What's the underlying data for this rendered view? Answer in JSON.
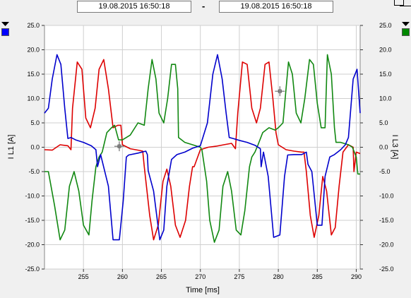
{
  "header": {
    "time_from": "19.08.2015     16:50:18",
    "separator": "-",
    "time_to": "19.08.2015     16:50:18"
  },
  "colors": {
    "I_L1": "#0000cc",
    "I_L2": "#dd0000",
    "I_L3": "#118811",
    "left_swatch": "#0000ff",
    "right_swatch": "#008800"
  },
  "icons": [
    "dropdown-arrow-icon",
    "window-restore-icon",
    "cursor-crosshair-icon"
  ],
  "chart_data": {
    "type": "line",
    "xlabel": "Time [ms]",
    "ylabel_left": "I L1 [A]",
    "ylabel_right": "I L3 [A]",
    "xlim": [
      250,
      290.5
    ],
    "ylim": [
      -25,
      25
    ],
    "x_ticks": [
      255,
      260,
      265,
      270,
      275,
      280,
      285,
      290
    ],
    "y_ticks": [
      "25.0",
      "20.0",
      "15.0",
      "10.0",
      "5.0",
      "0.0",
      "-5.0",
      "-10.0",
      "-15.0",
      "-20.0",
      "-25.0"
    ],
    "grid": true,
    "series": [
      {
        "key": "I_L1",
        "points": [
          [
            250,
            7
          ],
          [
            250.5,
            8
          ],
          [
            251,
            14
          ],
          [
            251.6,
            19
          ],
          [
            252.1,
            17
          ],
          [
            252.6,
            8
          ],
          [
            253,
            1.8
          ],
          [
            253.4,
            2
          ],
          [
            254,
            1.5
          ],
          [
            255,
            1
          ],
          [
            256,
            0.3
          ],
          [
            256.6,
            -0.5
          ],
          [
            256.8,
            -4
          ],
          [
            257.2,
            -1.5
          ],
          [
            258.2,
            -8
          ],
          [
            258.8,
            -19
          ],
          [
            259.6,
            -19
          ],
          [
            260.1,
            -11
          ],
          [
            260.5,
            -2
          ],
          [
            260.8,
            -1.6
          ],
          [
            262,
            -1.2
          ],
          [
            263,
            -0.8
          ],
          [
            263.2,
            -1.5
          ],
          [
            263.3,
            -4.8
          ],
          [
            264,
            -9
          ],
          [
            264.8,
            -19
          ],
          [
            265.3,
            -17
          ],
          [
            265.7,
            -8
          ],
          [
            266.3,
            -2.5
          ],
          [
            267,
            -1.5
          ],
          [
            268,
            -1
          ],
          [
            269,
            -0.2
          ],
          [
            270,
            0.3
          ],
          [
            270.9,
            5
          ],
          [
            271.6,
            15
          ],
          [
            272.2,
            19
          ],
          [
            272.8,
            14
          ],
          [
            273.3,
            7
          ],
          [
            273.7,
            2
          ],
          [
            274.2,
            1.8
          ],
          [
            275,
            1.4
          ],
          [
            276,
            1
          ],
          [
            277,
            0.4
          ],
          [
            277.7,
            -0.3
          ],
          [
            277.8,
            -4
          ],
          [
            278.1,
            -1
          ],
          [
            278.7,
            -6
          ],
          [
            279.4,
            -18.5
          ],
          [
            280.2,
            -18
          ],
          [
            280.8,
            -6
          ],
          [
            281.2,
            -1.6
          ],
          [
            282,
            -1.5
          ],
          [
            283,
            -1.5
          ],
          [
            283.6,
            -1
          ],
          [
            283.8,
            -3.5
          ],
          [
            284.3,
            -5
          ],
          [
            285,
            -16
          ],
          [
            285.6,
            -16
          ],
          [
            286,
            -6
          ],
          [
            286.6,
            -2
          ],
          [
            287.2,
            -1.5
          ],
          [
            288,
            -0.5
          ],
          [
            288.6,
            0.5
          ],
          [
            289,
            2
          ],
          [
            289.6,
            14
          ],
          [
            290.1,
            16
          ],
          [
            290.5,
            7
          ]
        ]
      },
      {
        "key": "I_L2",
        "points": [
          [
            250,
            -0.5
          ],
          [
            251,
            -0.6
          ],
          [
            252,
            0.5
          ],
          [
            253,
            0.3
          ],
          [
            253.4,
            -0.5
          ],
          [
            253.6,
            8
          ],
          [
            254.2,
            17.5
          ],
          [
            254.8,
            16
          ],
          [
            255.3,
            6
          ],
          [
            255.9,
            4
          ],
          [
            256.5,
            8
          ],
          [
            257,
            16
          ],
          [
            257.6,
            18
          ],
          [
            258.2,
            12
          ],
          [
            258.8,
            4
          ],
          [
            259.4,
            4.5
          ],
          [
            259.8,
            4.5
          ],
          [
            260,
            0.5
          ],
          [
            261,
            -0.3
          ],
          [
            262,
            -0.6
          ],
          [
            262.6,
            -0.8
          ],
          [
            262.8,
            -4
          ],
          [
            263.5,
            -14
          ],
          [
            264,
            -19
          ],
          [
            264.6,
            -16
          ],
          [
            265.2,
            -7
          ],
          [
            265.7,
            -4.5
          ],
          [
            266.2,
            -8
          ],
          [
            266.8,
            -16
          ],
          [
            267.4,
            -18.5
          ],
          [
            268.1,
            -15
          ],
          [
            268.6,
            -8
          ],
          [
            269,
            -4
          ],
          [
            269.2,
            -4
          ],
          [
            270,
            -0.5
          ],
          [
            271,
            0
          ],
          [
            272,
            0.2
          ],
          [
            273,
            0.5
          ],
          [
            274,
            0.8
          ],
          [
            274.5,
            -0.3
          ],
          [
            274.8,
            7
          ],
          [
            275.4,
            17.5
          ],
          [
            276,
            17
          ],
          [
            276.6,
            8
          ],
          [
            277.2,
            5
          ],
          [
            277.7,
            8
          ],
          [
            278.3,
            17
          ],
          [
            278.8,
            17.5
          ],
          [
            279.3,
            10
          ],
          [
            279.7,
            3
          ],
          [
            280,
            0.5
          ],
          [
            281,
            -0.5
          ],
          [
            282,
            -0.8
          ],
          [
            283,
            -1
          ],
          [
            283.3,
            -1
          ],
          [
            283.6,
            -5
          ],
          [
            284.1,
            -14
          ],
          [
            284.6,
            -18.5
          ],
          [
            285.2,
            -14
          ],
          [
            285.7,
            -6
          ],
          [
            286.2,
            -9
          ],
          [
            286.8,
            -18
          ],
          [
            287.3,
            -16.5
          ],
          [
            287.8,
            -8
          ],
          [
            288.3,
            -1
          ],
          [
            289,
            0.5
          ],
          [
            289.6,
            0
          ],
          [
            289.7,
            -5
          ],
          [
            290,
            -1
          ],
          [
            290.5,
            -1.3
          ]
        ]
      },
      {
        "key": "I_L3",
        "points": [
          [
            250,
            -5
          ],
          [
            250.5,
            -5
          ],
          [
            251.3,
            -12
          ],
          [
            252,
            -19
          ],
          [
            252.6,
            -17
          ],
          [
            253.2,
            -8
          ],
          [
            253.8,
            -5
          ],
          [
            254.4,
            -9
          ],
          [
            255,
            -16
          ],
          [
            255.7,
            -18
          ],
          [
            256.1,
            -11
          ],
          [
            256.6,
            -4
          ],
          [
            257,
            -2
          ],
          [
            257.4,
            -1
          ],
          [
            258,
            3
          ],
          [
            258.6,
            4
          ],
          [
            259,
            4.5
          ],
          [
            259.5,
            1.5
          ],
          [
            260,
            1.5
          ],
          [
            261,
            2.5
          ],
          [
            262,
            5
          ],
          [
            262.8,
            4.5
          ],
          [
            263.3,
            12
          ],
          [
            263.8,
            18
          ],
          [
            264.3,
            14
          ],
          [
            264.7,
            7
          ],
          [
            265.3,
            5
          ],
          [
            265.8,
            10
          ],
          [
            266.3,
            17
          ],
          [
            266.8,
            17
          ],
          [
            267.1,
            12
          ],
          [
            267.2,
            2
          ],
          [
            268,
            1
          ],
          [
            269,
            0.5
          ],
          [
            270,
            0
          ],
          [
            270.2,
            -0.5
          ],
          [
            270.8,
            -7
          ],
          [
            271.2,
            -15
          ],
          [
            271.8,
            -19.5
          ],
          [
            272.4,
            -17
          ],
          [
            272.9,
            -8
          ],
          [
            273.5,
            -5
          ],
          [
            274,
            -9
          ],
          [
            274.6,
            -17
          ],
          [
            275.2,
            -18
          ],
          [
            275.7,
            -13
          ],
          [
            276.3,
            -4
          ],
          [
            276.6,
            -2
          ],
          [
            277,
            -1
          ],
          [
            277.4,
            0.5
          ],
          [
            278,
            3
          ],
          [
            278.8,
            4
          ],
          [
            279.6,
            3.5
          ],
          [
            280,
            4
          ],
          [
            280.6,
            5
          ],
          [
            281.3,
            17.5
          ],
          [
            281.8,
            15
          ],
          [
            282.3,
            7
          ],
          [
            282.9,
            5
          ],
          [
            283.4,
            10
          ],
          [
            284,
            18
          ],
          [
            284.5,
            17
          ],
          [
            285,
            9
          ],
          [
            285.5,
            4
          ],
          [
            286,
            4
          ],
          [
            286.3,
            19
          ],
          [
            286.8,
            15
          ],
          [
            287.2,
            4
          ],
          [
            287.4,
            1
          ],
          [
            288,
            1
          ],
          [
            289,
            0.5
          ],
          [
            289.5,
            0
          ],
          [
            290,
            -2
          ],
          [
            290.2,
            -5.5
          ],
          [
            290.5,
            -5.5
          ]
        ]
      }
    ]
  }
}
